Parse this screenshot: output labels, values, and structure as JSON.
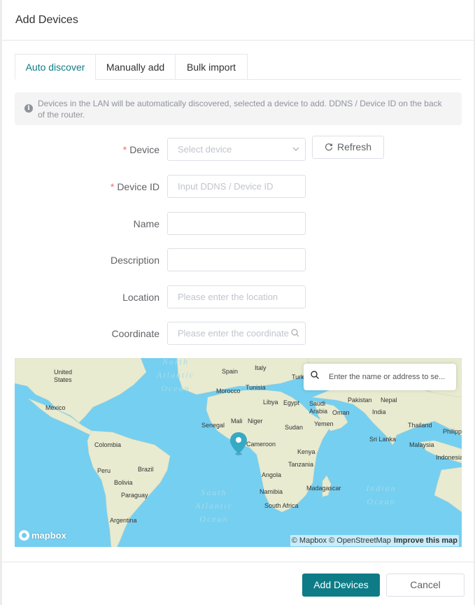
{
  "modal": {
    "title": "Add Devices"
  },
  "tabs": [
    {
      "label": "Auto discover",
      "active": true
    },
    {
      "label": "Manually add",
      "active": false
    },
    {
      "label": "Bulk import",
      "active": false
    }
  ],
  "alert": {
    "text": "Devices in the LAN will be automatically discovered, selected a device to add. DDNS / Device ID on the back of the router."
  },
  "form": {
    "device": {
      "label": "Device",
      "required": true,
      "placeholder": "Select device"
    },
    "refresh_label": "Refresh",
    "device_id": {
      "label": "Device ID",
      "required": true,
      "placeholder": "Input DDNS / Device ID"
    },
    "name": {
      "label": "Name",
      "value": ""
    },
    "description": {
      "label": "Description",
      "value": ""
    },
    "location": {
      "label": "Location",
      "placeholder": "Please enter the location"
    },
    "coordinate": {
      "label": "Coordinate",
      "placeholder": "Please enter the coordinate"
    }
  },
  "map": {
    "search_placeholder": "Enter the name or address to se...",
    "logo_text": "mapbox",
    "attribution": "© Mapbox © OpenStreetMap",
    "improve_text": "Improve this map",
    "oceans": {
      "north_atlantic": "North\nAtlantic\nOcean",
      "south_atlantic": "South\nAtlantic\nOcean",
      "indian": "Indian\nOcean"
    },
    "labels": {
      "united_states": "United\nStates",
      "mexico": "Mexico",
      "colombia": "Colombia",
      "peru": "Peru",
      "brazil": "Brazil",
      "bolivia": "Bolivia",
      "paraguay": "Paraguay",
      "argentina": "Argentina",
      "spain": "Spain",
      "italy": "Italy",
      "turk": "Turk",
      "morocco": "Morocco",
      "tunisia": "Tunisia",
      "libya": "Libya",
      "egypt": "Egypt",
      "saudi_arabia": "Saudi\nArabia",
      "oman": "Oman",
      "yemen": "Yemen",
      "pakistan": "Pakistan",
      "nepal": "Nepal",
      "india": "India",
      "thailand": "Thailand",
      "sri_lanka": "Sri Lanka",
      "malaysia": "Malaysia",
      "philippines": "Philipp",
      "indonesia": "Indonesia",
      "senegal": "Senegal",
      "mali": "Mali",
      "niger": "Niger",
      "sudan": "Sudan",
      "cameroon": "Cameroon",
      "kenya": "Kenya",
      "tanzania": "Tanzania",
      "angola": "Angola",
      "namibia": "Namibia",
      "madagascar": "Madagascar",
      "south_africa": "South Africa"
    }
  },
  "footer": {
    "confirm_label": "Add Devices",
    "cancel_label": "Cancel"
  },
  "colors": {
    "primary": "#0e7c86",
    "required": "#f56c6c",
    "ocean": "#75cff0",
    "land": "#e8ebd0",
    "pin": "#36a9c4"
  }
}
